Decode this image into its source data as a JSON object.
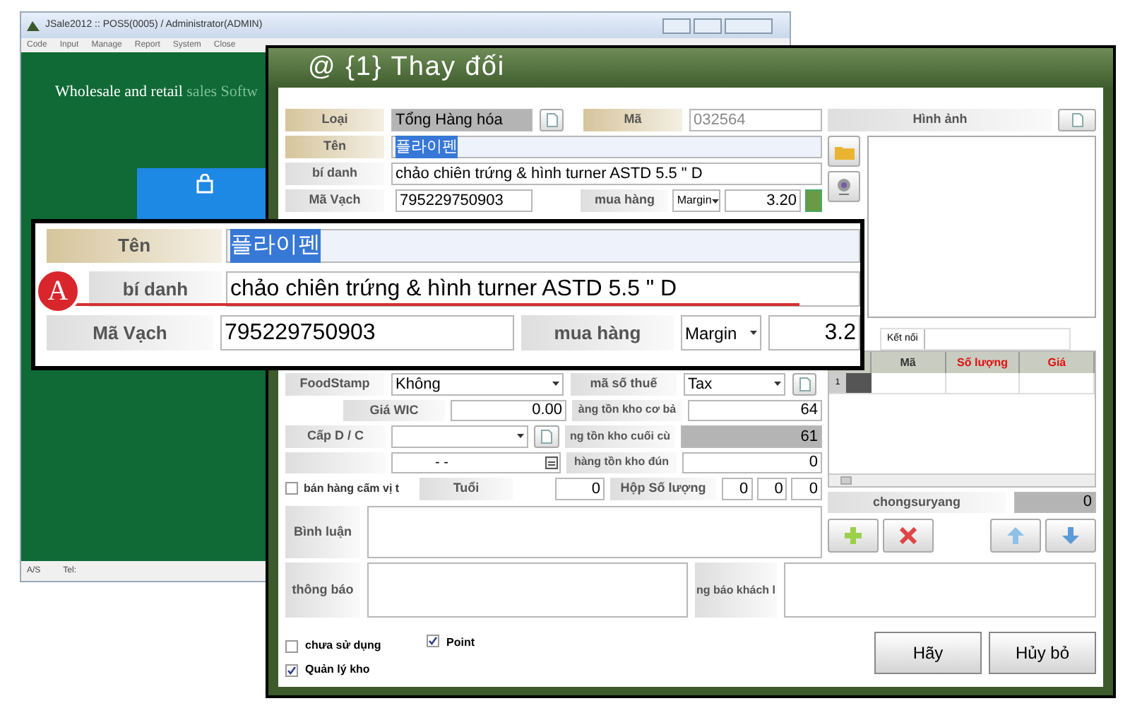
{
  "app_window": {
    "title": "JSale2012  ::  POS5(0005) / Administrator(ADMIN)",
    "menu": [
      "Code",
      "Input",
      "Manage",
      "Report",
      "System",
      "Close"
    ],
    "banner": {
      "text": "Wholesale and retail",
      "faded_text": "sales Softw"
    },
    "status_bar": [
      "A/S",
      "Tel:"
    ]
  },
  "dialog": {
    "title": "@ {1} Thay đối",
    "loai": {
      "label": "Loại",
      "value": "Tổng Hàng hóa"
    },
    "ma": {
      "label": "Mã",
      "value": "032564"
    },
    "ten": {
      "label": "Tên",
      "value": "플라이펜",
      "highlighted": true
    },
    "bi_danh": {
      "label": "bí danh",
      "value": "chảo chiên trứng & hình turner ASTD 5.5 \" D"
    },
    "ma_vach": {
      "label": "Mã Vạch",
      "value": "795229750903"
    },
    "mua_hang": {
      "label": "mua hàng",
      "mode": "Margin",
      "value": "3.20"
    },
    "foodstamp": {
      "label": "FoodStamp",
      "value": "Không"
    },
    "ma_so_thue": {
      "label": "mã số thuế",
      "value": "Tax"
    },
    "gia_wic": {
      "label": "Giá WIC",
      "value": "0.00"
    },
    "ton_kho_co_ban": {
      "label": "àng tồn kho cơ bả",
      "value": "64"
    },
    "cap_dc": {
      "label": "Cấp D / C"
    },
    "ton_kho_cuoi": {
      "label": "ng tồn kho cuối cù",
      "value": "61"
    },
    "date": {
      "value": "- -"
    },
    "ton_kho_dung": {
      "label": "hàng tồn kho đún",
      "value": "0"
    },
    "age_restricted": {
      "label": "bán hàng cấm vị t",
      "checked": false
    },
    "tuoi": {
      "label": "Tuổi",
      "value": "0"
    },
    "hop_so_luong": {
      "label": "Hộp Số lượng",
      "values": [
        "0",
        "0",
        "0"
      ]
    },
    "binh_luan": {
      "label": "Bình luận"
    },
    "thong_bao": {
      "label": "thông báo"
    },
    "thong_bao_khach": {
      "label": "ng báo khách l"
    },
    "checkboxes": [
      {
        "label": "chưa sử dụng",
        "checked": false
      },
      {
        "label": "Quản lý kho",
        "checked": true
      },
      {
        "label": "Point",
        "checked": true
      }
    ],
    "buttons": [
      "Hãy",
      "Hủy bỏ"
    ],
    "image_panel": {
      "label": "Hình ảnh"
    },
    "tabs": [
      {
        "label": "Kết nối",
        "selected": true
      }
    ],
    "grid": {
      "columns": [
        "Mã",
        "Số lượng",
        "Giá"
      ],
      "rows": [
        {
          "number": "1",
          "selected": true
        }
      ]
    },
    "chongsuryang": {
      "label": "chongsuryang",
      "value": "0"
    }
  },
  "callout": {
    "marker": "A",
    "ten": {
      "label": "Tên",
      "value": "플라이펜",
      "highlighted": true
    },
    "bi_danh": {
      "label": "bí danh",
      "value": "chảo chiên trứng & hình turner ASTD 5.5 \" D"
    },
    "ma_vach": {
      "label": "Mã Vạch",
      "value": "795229750903"
    },
    "mua_hang": {
      "label": "mua hàng",
      "mode": "Margin",
      "value": "3.2"
    }
  }
}
